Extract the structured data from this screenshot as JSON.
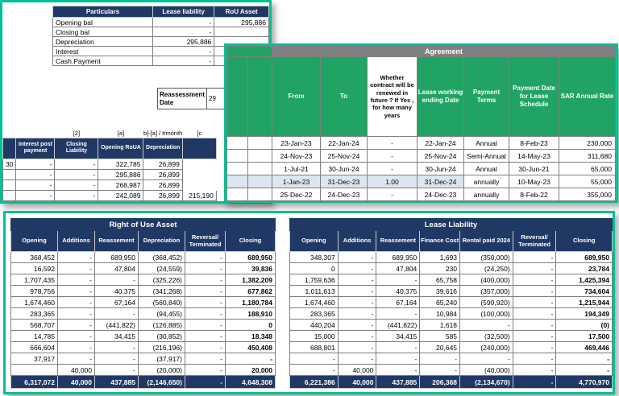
{
  "colors": {
    "panel_border_teal": "#00c096",
    "header_navy": "#203864",
    "header_green": "#21a366",
    "title_gray": "#808080",
    "highlight_blue": "#dce6f1"
  },
  "summary": {
    "headers": [
      "Particulars",
      "Lease liability",
      "RoU Asset"
    ],
    "rows": [
      [
        "Opening bal",
        "-",
        "295,886"
      ],
      [
        "Closing bal",
        "-",
        ""
      ],
      [
        "Depreciation",
        "295,886",
        ""
      ],
      [
        "Interest",
        "-",
        ""
      ],
      [
        "Cash Payment",
        "-",
        ""
      ]
    ]
  },
  "reassessment": {
    "label": "Reassessment Date",
    "value": "29"
  },
  "schedule": {
    "formula_row": [
      "",
      "",
      "[2]",
      "[a]",
      "b]-[a] / #month",
      "[c"
    ],
    "headers": [
      "",
      "Interest post payment",
      "Closing Liability",
      "Opening RoUA",
      "Depreciation",
      ""
    ],
    "rows": [
      [
        "30",
        "-",
        "-",
        "322,785",
        "26,899",
        ""
      ],
      [
        "",
        "-",
        "-",
        "295,886",
        "26,899",
        ""
      ],
      [
        "",
        "-",
        "-",
        "268,987",
        "26,899",
        ""
      ],
      [
        "",
        "-",
        "-",
        "242,089",
        "26,899",
        "215,190"
      ]
    ]
  },
  "agreement": {
    "title": "Agreement",
    "headers": [
      "From",
      "To",
      "Whether contract will be renewed in future ? If Yes , for how many years",
      "Lease working ending Date",
      "Payment Terms",
      "Payment Date for Lease Schedule",
      "SAR Annual Rate"
    ],
    "highlighted_row": 3,
    "rows": [
      [
        "23-Jan-23",
        "22-Jan-24",
        "-",
        "22-Jan-24",
        "Annual",
        "8-Feb-23",
        "230,000"
      ],
      [
        "24-Nov-23",
        "25-Nov-24",
        "-",
        "25-Nov-24",
        "Semi-Annual",
        "14-May-23",
        "311,680"
      ],
      [
        "1-Jul-21",
        "30-Jun-24",
        "-",
        "30-Jun-24",
        "Annual",
        "30-Jun-21",
        "65,000"
      ],
      [
        "1-Jan-23",
        "31-Dec-23",
        "1.00",
        "31-Dec-24",
        "annually",
        "10-May-23",
        "55,000"
      ],
      [
        "25-Dec-22",
        "24-Dec-23",
        "-",
        "24-Dec-23",
        "annually",
        "8-Feb-22",
        "355,000"
      ]
    ]
  },
  "rou": {
    "title": "Right of Use Asset",
    "headers": [
      "Opening",
      "Additions",
      "Reassement",
      "Depreciation",
      "Reversal/ Terminated",
      "Closing"
    ],
    "rows": [
      [
        "368,452",
        "-",
        "689,950",
        "(368,452)",
        "-",
        "689,950"
      ],
      [
        "16,592",
        "-",
        "47,804",
        "(24,559)",
        "-",
        "39,836"
      ],
      [
        "1,707,435",
        "-",
        "-",
        "(325,226)",
        "-",
        "1,382,209"
      ],
      [
        "978,756",
        "-",
        "40,375",
        "(341,268)",
        "-",
        "677,862"
      ],
      [
        "1,674,460",
        "-",
        "67,164",
        "(560,840)",
        "-",
        "1,180,784"
      ],
      [
        "283,365",
        "-",
        "-",
        "(94,455)",
        "-",
        "188,910"
      ],
      [
        "568,707",
        "-",
        "(441,822)",
        "(126,885)",
        "-",
        "0"
      ],
      [
        "14,785",
        "-",
        "34,415",
        "(30,852)",
        "-",
        "18,348"
      ],
      [
        "666,604",
        "-",
        "-",
        "(216,196)",
        "-",
        "450,408"
      ],
      [
        "37,917",
        "-",
        "-",
        "(37,917)",
        "-",
        "-"
      ],
      [
        "",
        "40,000",
        "-",
        "(20,000)",
        "-",
        "20,000"
      ]
    ],
    "total": [
      "6,317,072",
      "40,000",
      "437,885",
      "(2,146,650)",
      "-",
      "4,648,308"
    ]
  },
  "lease": {
    "title": "Lease Liability",
    "headers": [
      "Opening",
      "Additions",
      "Reassement",
      "Finance Cost",
      "Rental paid 2024",
      "Reversal/ Terminated",
      "Closing"
    ],
    "rows": [
      [
        "348,307",
        "-",
        "689,950",
        "1,693",
        "(350,000)",
        "-",
        "689,950"
      ],
      [
        "0",
        "-",
        "47,804",
        "230",
        "(24,250)",
        "-",
        "23,784"
      ],
      [
        "1,759,636",
        "-",
        "-",
        "65,758",
        "(400,000)",
        "-",
        "1,425,394"
      ],
      [
        "1,011,613",
        "-",
        "40,375",
        "39,616",
        "(357,000)",
        "-",
        "734,604"
      ],
      [
        "1,674,460",
        "-",
        "67,164",
        "65,240",
        "(590,920)",
        "-",
        "1,215,944"
      ],
      [
        "283,365",
        "-",
        "-",
        "10,984",
        "(100,000)",
        "-",
        "194,349"
      ],
      [
        "440,204",
        "-",
        "(441,822)",
        "1,618",
        "-",
        "-",
        "(0)"
      ],
      [
        "15,000",
        "-",
        "34,415",
        "585",
        "(32,500)",
        "-",
        "17,500"
      ],
      [
        "688,801",
        "-",
        "-",
        "20,645",
        "(240,000)",
        "-",
        "469,446"
      ],
      [
        "-",
        "-",
        "-",
        "-",
        "-",
        "-",
        "-"
      ],
      [
        "-",
        "40,000",
        "-",
        "-",
        "(40,000)",
        "-",
        "-"
      ]
    ],
    "total": [
      "6,221,386",
      "40,000",
      "437,885",
      "206,368",
      "(2,134,670)",
      "-",
      "4,770,970"
    ]
  }
}
